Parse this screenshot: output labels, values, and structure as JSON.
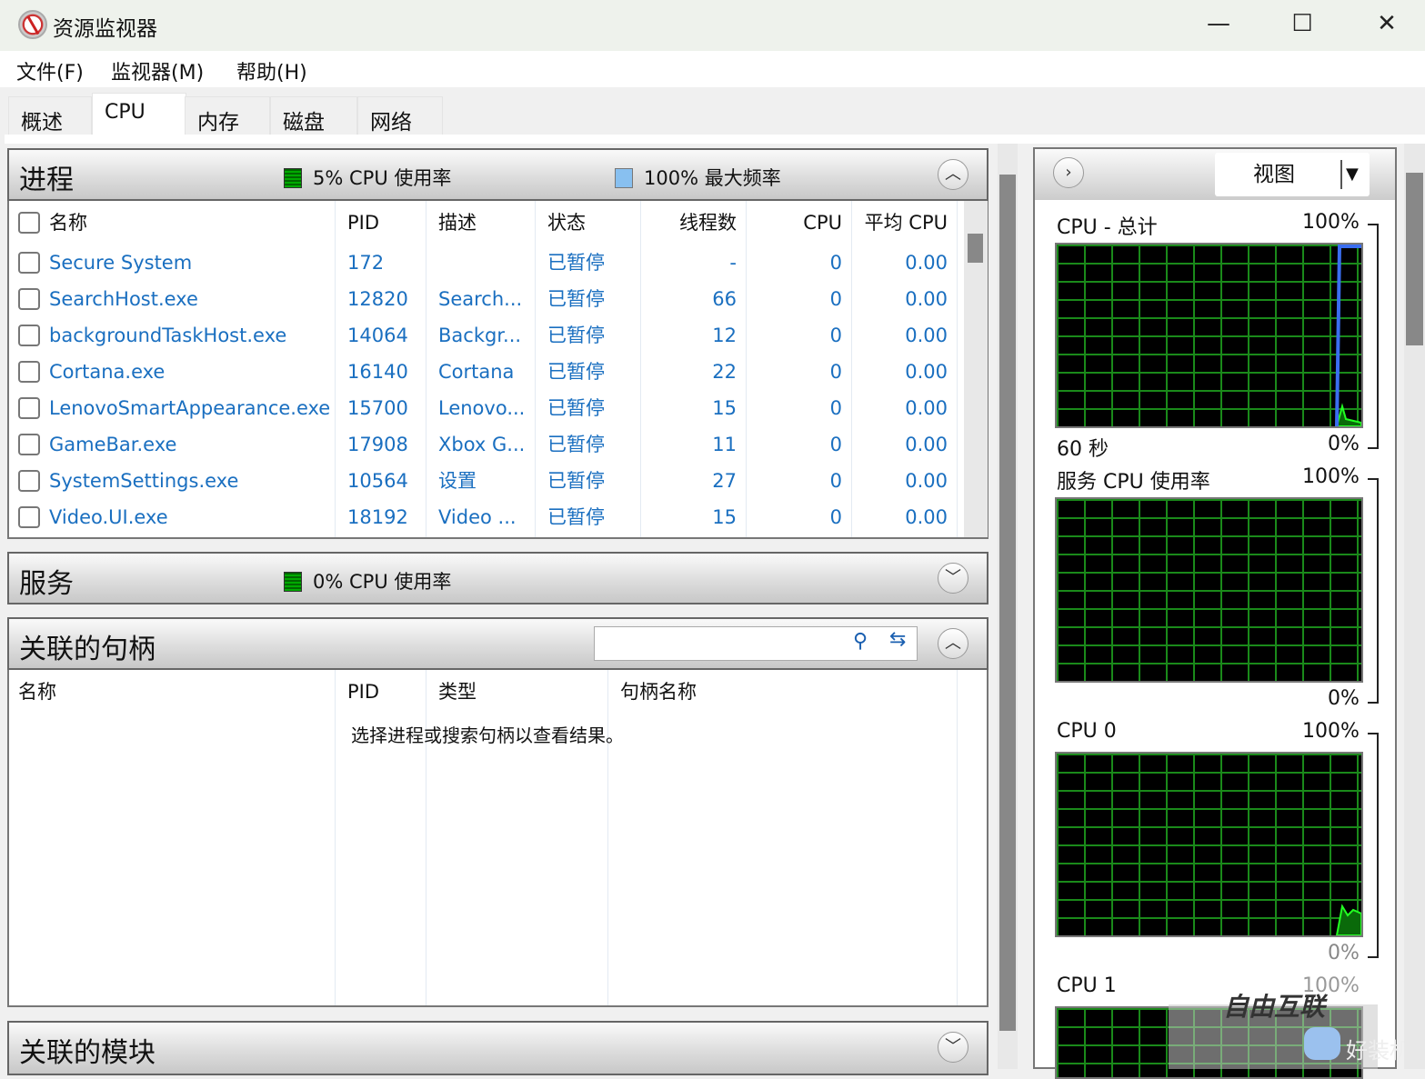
{
  "window": {
    "title": "资源监视器",
    "minimize": "—",
    "maximize": "☐",
    "close": "✕"
  },
  "menu": [
    "文件(F)",
    "监视器(M)",
    "帮助(H)"
  ],
  "tabs": [
    "概述",
    "CPU",
    "内存",
    "磁盘",
    "网络"
  ],
  "processes": {
    "title": "进程",
    "cpu_usage": "5% CPU 使用率",
    "max_freq": "100% 最大频率",
    "columns": [
      "名称",
      "PID",
      "描述",
      "状态",
      "线程数",
      "CPU",
      "平均 CPU"
    ],
    "rows": [
      {
        "name": "Secure System",
        "pid": "172",
        "desc": "",
        "status": "已暂停",
        "threads": "-",
        "cpu": "0",
        "avg": "0.00"
      },
      {
        "name": "SearchHost.exe",
        "pid": "12820",
        "desc": "Search...",
        "status": "已暂停",
        "threads": "66",
        "cpu": "0",
        "avg": "0.00"
      },
      {
        "name": "backgroundTaskHost.exe",
        "pid": "14064",
        "desc": "Backgr...",
        "status": "已暂停",
        "threads": "12",
        "cpu": "0",
        "avg": "0.00"
      },
      {
        "name": "Cortana.exe",
        "pid": "16140",
        "desc": "Cortana",
        "status": "已暂停",
        "threads": "22",
        "cpu": "0",
        "avg": "0.00"
      },
      {
        "name": "LenovoSmartAppearance.exe",
        "pid": "15700",
        "desc": "Lenovo...",
        "status": "已暂停",
        "threads": "15",
        "cpu": "0",
        "avg": "0.00"
      },
      {
        "name": "GameBar.exe",
        "pid": "17908",
        "desc": "Xbox G...",
        "status": "已暂停",
        "threads": "11",
        "cpu": "0",
        "avg": "0.00"
      },
      {
        "name": "SystemSettings.exe",
        "pid": "10564",
        "desc": "设置",
        "status": "已暂停",
        "threads": "27",
        "cpu": "0",
        "avg": "0.00"
      },
      {
        "name": "Video.UI.exe",
        "pid": "18192",
        "desc": "Video ...",
        "status": "已暂停",
        "threads": "15",
        "cpu": "0",
        "avg": "0.00"
      }
    ]
  },
  "services": {
    "title": "服务",
    "cpu_usage": "0% CPU 使用率"
  },
  "handles": {
    "title": "关联的句柄",
    "search_value": "",
    "columns": [
      "名称",
      "PID",
      "类型",
      "句柄名称"
    ],
    "empty_message": "选择进程或搜索句柄以查看结果。"
  },
  "modules": {
    "title": "关联的模块"
  },
  "right": {
    "view_label": "视图",
    "graphs": [
      {
        "title": "CPU - 总计",
        "max": "100%",
        "min": "0%",
        "time": "60 秒"
      },
      {
        "title": "服务 CPU 使用率",
        "max": "100%",
        "min": "0%"
      },
      {
        "title": "CPU 0",
        "max": "100%",
        "min": "0%"
      },
      {
        "title": "CPU 1",
        "max": "100%"
      }
    ]
  },
  "watermark": [
    "自由互联",
    "好装机"
  ],
  "colors": {
    "link": "#1a6fc0",
    "grid": "#1a8a1a",
    "freq_line": "#3a6ef0",
    "usage": "#22cc22"
  }
}
